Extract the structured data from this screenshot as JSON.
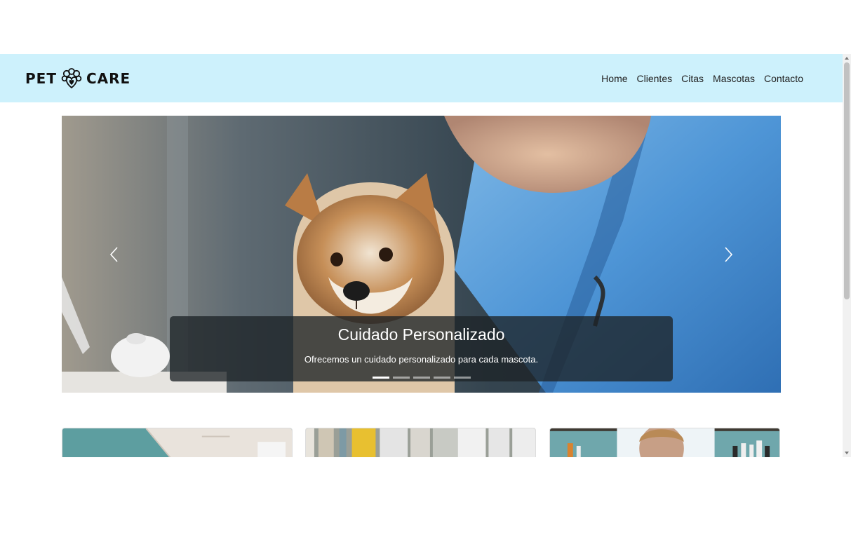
{
  "navbar": {
    "brand_left": "PET",
    "brand_right": "CARE",
    "logo_icon": "paw-heart-icon",
    "links": [
      {
        "label": "Home"
      },
      {
        "label": "Clientes"
      },
      {
        "label": "Citas"
      },
      {
        "label": "Mascotas"
      },
      {
        "label": "Contacto"
      }
    ]
  },
  "carousel": {
    "caption_title": "Cuidado Personalizado",
    "caption_text": "Ofrecemos un cuidado personalizado para cada mascota.",
    "slide_count": 5,
    "active_index": 0,
    "prev_icon": "chevron-left-icon",
    "next_icon": "chevron-right-icon"
  },
  "colors": {
    "navbar_bg": "#cdf1fc",
    "caption_bg": "#1e2428"
  }
}
